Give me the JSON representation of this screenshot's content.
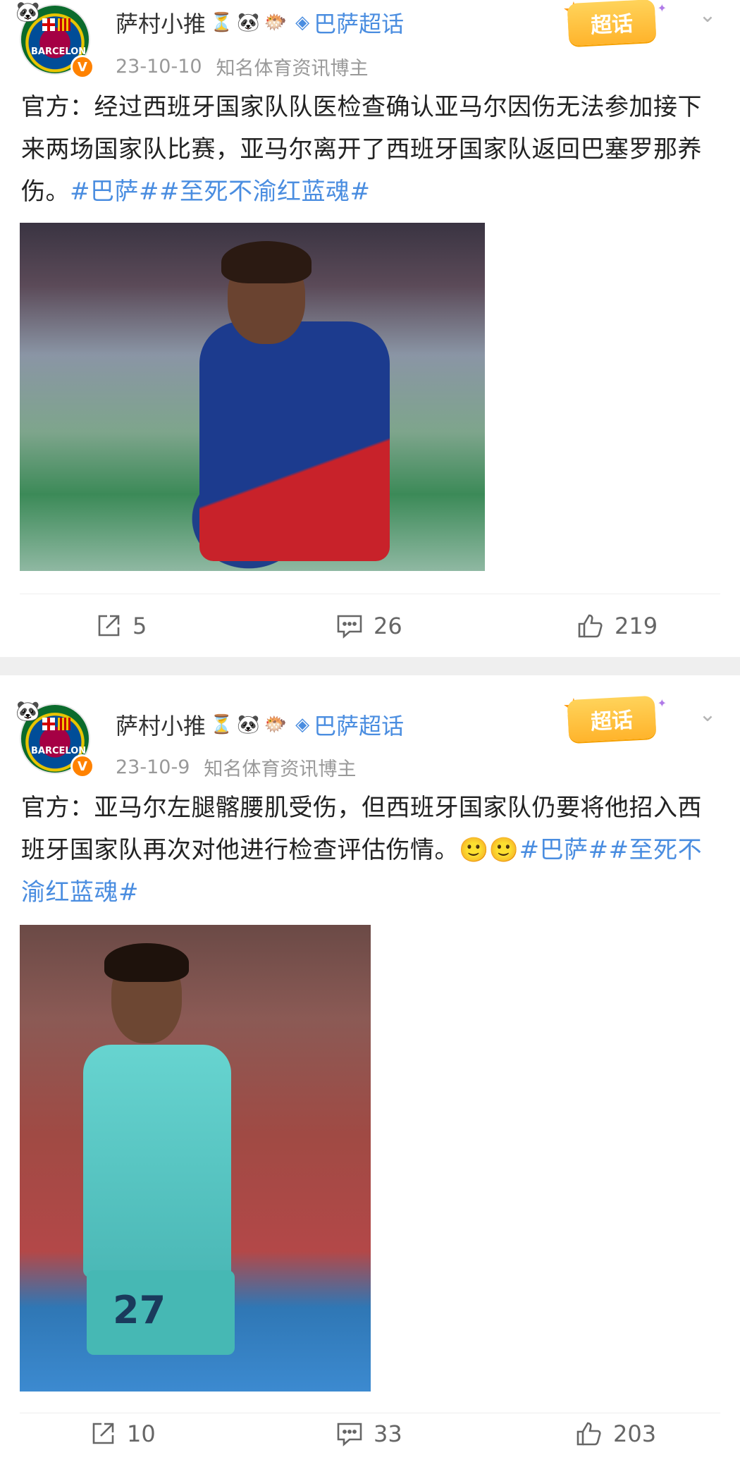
{
  "posts": [
    {
      "username": "萨村小推",
      "name_emojis": [
        "⏳",
        "🐼",
        "🐡"
      ],
      "topic_icon": "diamond-icon",
      "topic": "巴萨超话",
      "supertopic_badge": "超话",
      "date": "23-10-10",
      "tagline": "知名体育资讯博主",
      "text_plain": "官方：经过西班牙国家队队医检查确认亚马尔因伤无法参加接下来两场国家队比赛，亚马尔离开了西班牙国家队返回巴塞罗那养伤。",
      "hashtags": "#巴萨##至死不渝红蓝魂#",
      "reposts": "5",
      "comments": "26",
      "likes": "219"
    },
    {
      "username": "萨村小推",
      "name_emojis": [
        "⏳",
        "🐼",
        "🐡"
      ],
      "topic_icon": "diamond-icon",
      "topic": "巴萨超话",
      "supertopic_badge": "超话",
      "date": "23-10-9",
      "tagline": "知名体育资讯博主",
      "text_plain": "官方：亚马尔左腿髂腰肌受伤，但西班牙国家队仍要将他招入西班牙国家队再次对他进行检查评估伤情。",
      "smileys": "🙂🙂",
      "hashtags": "#巴萨##至死不渝红蓝魂#",
      "jersey_number": "27",
      "reposts": "10",
      "comments": "33",
      "likes": "203"
    }
  ],
  "avatar": {
    "crest_text": "BARCELONA",
    "verified_badge": "V"
  },
  "colors": {
    "link": "#4a8de0",
    "meta": "#999999",
    "badge": "#ffb42c",
    "verified": "#ff8200"
  }
}
